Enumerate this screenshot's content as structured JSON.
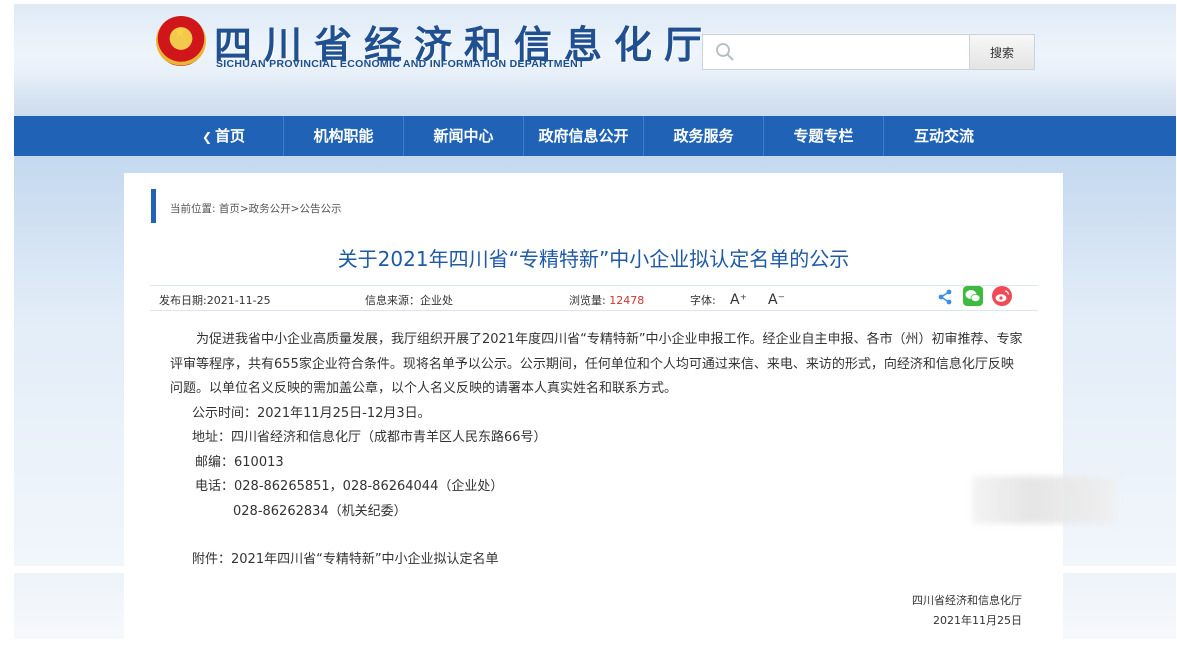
{
  "header": {
    "site_title": "四川省经济和信息化厅",
    "site_subtitle": "SICHUAN PROVINCIAL ECONOMIC AND INFORMATION DEPARTMENT",
    "emblem_icon": "national-emblem-icon",
    "search": {
      "placeholder": "",
      "button_label": "搜索",
      "icon": "search-icon"
    }
  },
  "nav": {
    "items": [
      {
        "label": "首页",
        "icon": "home-icon"
      },
      {
        "label": "机构职能"
      },
      {
        "label": "新闻中心"
      },
      {
        "label": "政府信息公开"
      },
      {
        "label": "政务服务"
      },
      {
        "label": "专题专栏"
      },
      {
        "label": "互动交流"
      }
    ],
    "color": "#1f62b6"
  },
  "breadcrumb": "当前位置: 首页>政务公开>公告公示",
  "article": {
    "title": "关于2021年四川省“专精特新”中小企业拟认定名单的公示",
    "meta": {
      "publish_date": "发布日期:2021-11-25",
      "source": "信息来源：企业处",
      "views_label": "浏览量:",
      "views_count": "12478",
      "font_label": "字体:",
      "font_up": "A⁺",
      "font_down": "A⁻"
    },
    "paragraph": "为促进我省中小企业高质量发展，我厅组织开展了2021年度四川省“专精特新”中小企业申报工作。经企业自主申报、各市（州）初审推荐、专家评审等程序，共有655家企业符合条件。现将名单予以公示。公示期间，任何单位和个人均可通过来信、来电、来访的形式，向经济和信息化厅反映问题。以单位名义反映的需加盖公章，以个人名义反映的请署本人真实姓名和联系方式。",
    "period": "公示时间：2021年11月25日-12月3日。",
    "address": "地址：四川省经济和信息化厅（成都市青羊区人民东路66号）",
    "postcode": "邮编：610013",
    "phone": "电话：028-86265851，028-86264044（企业处）",
    "phone2": "028-86262834（机关纪委）",
    "attachment": "附件：2021年四川省“专精特新”中小企业拟认定名单",
    "signature_org": "四川省经济和信息化厅",
    "signature_date": "2021年11月25日"
  },
  "share_icons": [
    "share-icon",
    "wechat-icon",
    "weibo-icon"
  ],
  "colors": {
    "title": "#1f5aa6",
    "views_count": "#d8322e",
    "accent": "#1f62b6"
  }
}
